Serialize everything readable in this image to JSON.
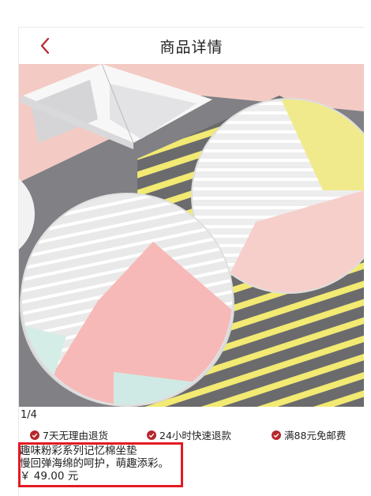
{
  "header": {
    "title": "商品详情",
    "back_icon": "chevron-left-icon"
  },
  "gallery": {
    "counter": "1/4"
  },
  "services": [
    {
      "label": "7天无理由退货",
      "icon": "check-circle-icon"
    },
    {
      "label": "24小时快速退款",
      "icon": "check-circle-icon"
    },
    {
      "label": "满88元免邮费",
      "icon": "check-circle-icon"
    }
  ],
  "product": {
    "name": "趣味粉彩系列记忆棉坐垫",
    "description": "慢回弹海绵的呵护，萌趣添彩。",
    "price": "￥ 49.00 元"
  },
  "colors": {
    "accent": "#b4282d",
    "highlight": "#e31b23"
  }
}
